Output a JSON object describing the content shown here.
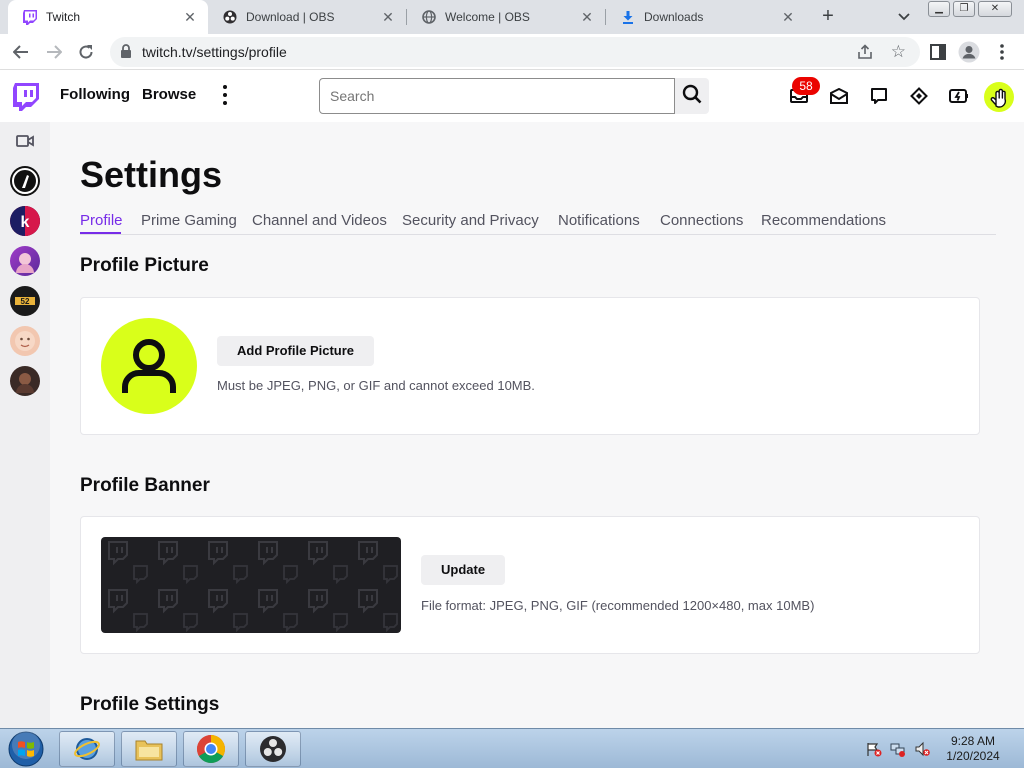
{
  "browser": {
    "tabs": [
      {
        "title": "Twitch",
        "icon": "twitch-icon"
      },
      {
        "title": "Download | OBS",
        "icon": "obs-icon"
      },
      {
        "title": "Welcome | OBS",
        "icon": "globe-icon"
      },
      {
        "title": "Downloads",
        "icon": "download-icon"
      }
    ],
    "url": "twitch.tv/settings/profile"
  },
  "twitch": {
    "nav": {
      "following": "Following",
      "browse": "Browse"
    },
    "search_placeholder": "Search",
    "notification_count": "58",
    "brand_color": "#9146ff",
    "accent_color": "#772ce8",
    "avatar_color": "#d9ff1a"
  },
  "sidebar": {
    "channels": [
      {
        "icon": "channel-avatar-1"
      },
      {
        "icon": "channel-avatar-2"
      },
      {
        "icon": "channel-avatar-3"
      },
      {
        "icon": "channel-avatar-4"
      },
      {
        "icon": "channel-avatar-5"
      },
      {
        "icon": "channel-avatar-6"
      }
    ]
  },
  "settings": {
    "title": "Settings",
    "tabs": [
      "Profile",
      "Prime Gaming",
      "Channel and Videos",
      "Security and Privacy",
      "Notifications",
      "Connections",
      "Recommendations"
    ],
    "active_tab": "Profile",
    "profile_picture": {
      "heading": "Profile Picture",
      "button": "Add Profile Picture",
      "hint": "Must be JPEG, PNG, or GIF and cannot exceed 10MB."
    },
    "profile_banner": {
      "heading": "Profile Banner",
      "button": "Update",
      "hint": "File format: JPEG, PNG, GIF (recommended 1200×480, max 10MB)"
    },
    "profile_settings": {
      "heading": "Profile Settings"
    }
  },
  "taskbar": {
    "time": "9:28 AM",
    "date": "1/20/2024"
  }
}
